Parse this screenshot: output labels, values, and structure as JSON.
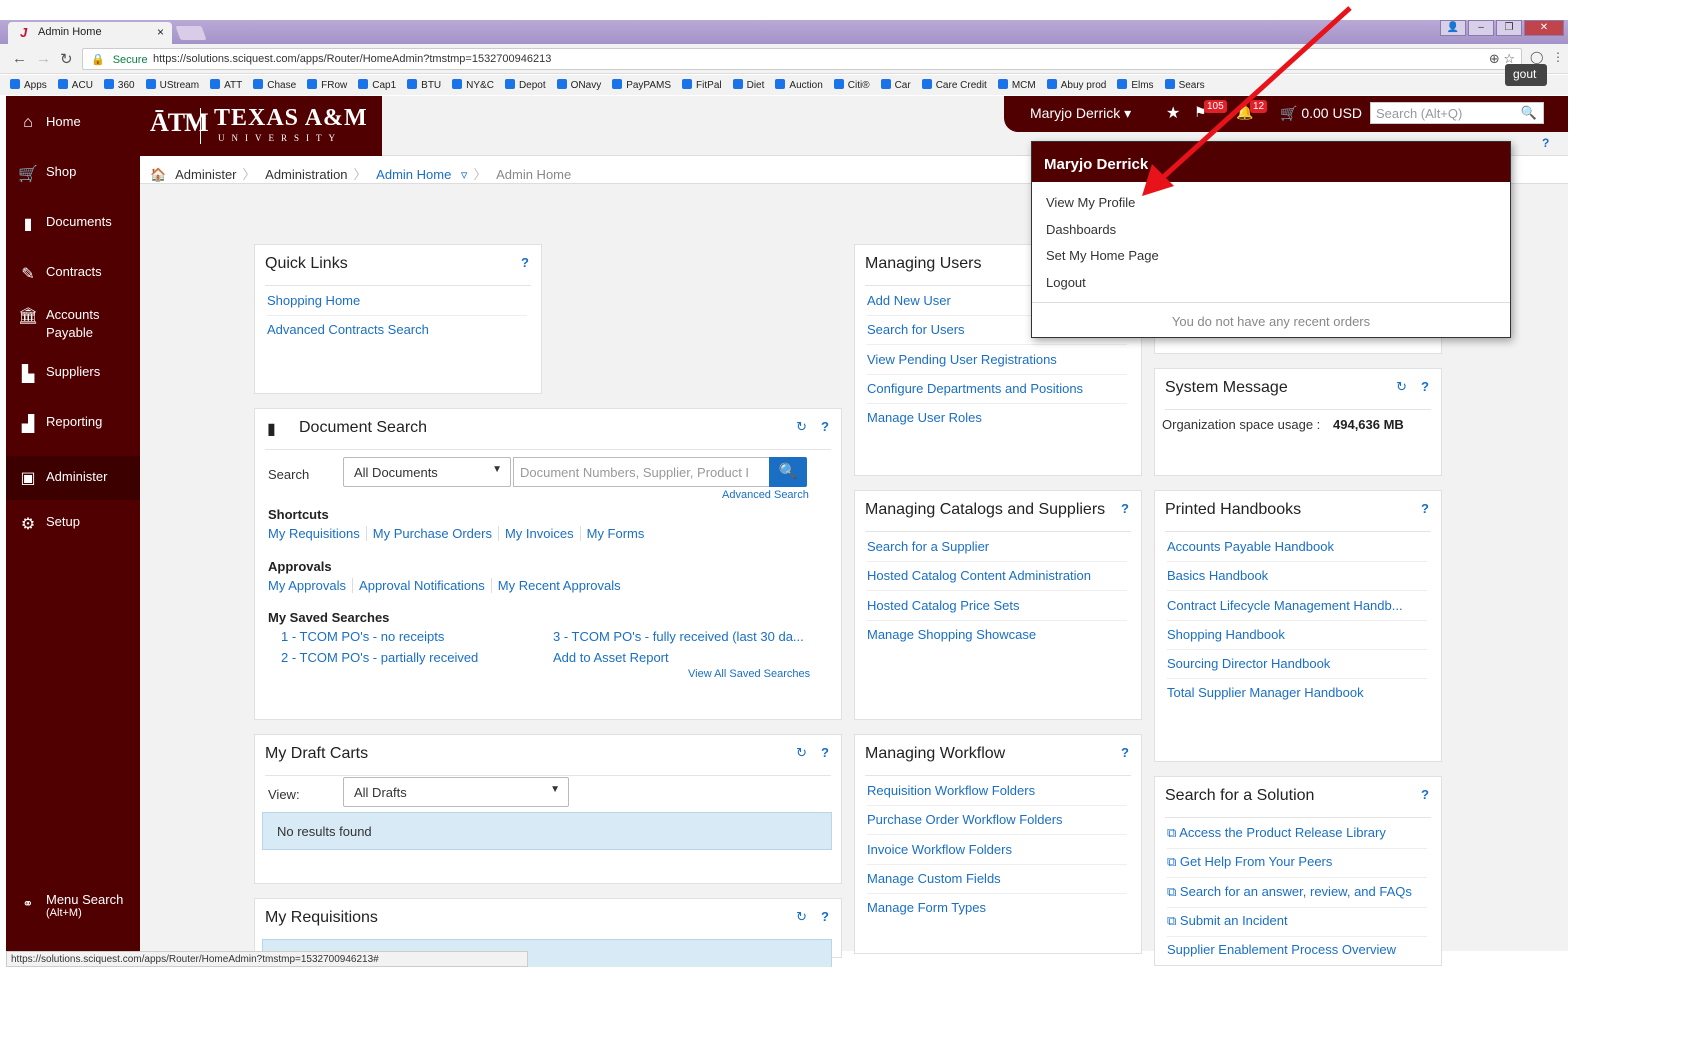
{
  "browser": {
    "tab_title": "Admin Home",
    "secure_label": "Secure",
    "url": "https://solutions.sciquest.com/apps/Router/HomeAdmin?tmstmp=1532700946213",
    "bookmarks": [
      "Apps",
      "ACU",
      "360",
      "UStream",
      "ATT",
      "Chase",
      "FRow",
      "Cap1",
      "BTU",
      "NY&C",
      "Depot",
      "ONavy",
      "PayPAMS",
      "FitPal",
      "Diet",
      "Auction",
      "Citi®",
      "Car",
      "Care Credit",
      "MCM",
      "Abuy prod",
      "Elms",
      "Sears"
    ],
    "status_url": "https://solutions.sciquest.com/apps/Router/HomeAdmin?tmstmp=1532700946213#"
  },
  "logo": {
    "atm": "ĀTM",
    "name": "TEXAS A&M",
    "sub": "UNIVERSITY"
  },
  "sidebar": {
    "items": [
      {
        "label": "Home",
        "icon": "home-icon"
      },
      {
        "label": "Shop",
        "icon": "cart-icon"
      },
      {
        "label": "Documents",
        "icon": "documents-icon"
      },
      {
        "label": "Contracts",
        "icon": "contracts-icon"
      },
      {
        "label": "Accounts Payable",
        "icon": "bank-icon"
      },
      {
        "label": "Suppliers",
        "icon": "suppliers-icon"
      },
      {
        "label": "Reporting",
        "icon": "chart-icon"
      },
      {
        "label": "Administer",
        "icon": "administer-icon"
      },
      {
        "label": "Setup",
        "icon": "gear-icon"
      }
    ],
    "menu_search": "Menu Search",
    "menu_search_shortcut": "(Alt+M)"
  },
  "userbar": {
    "name": "Maryjo Derrick",
    "flag_count": "105",
    "bell_count": "12",
    "cart_total": "0.00 USD",
    "search_placeholder": "Search (Alt+Q)"
  },
  "breadcrumb": {
    "items": [
      "Administer",
      "Administration",
      "Admin Home",
      "Admin Home"
    ],
    "logout_partial": "gout"
  },
  "quick_links": {
    "title": "Quick Links",
    "links": [
      "Shopping Home",
      "Advanced Contracts Search"
    ]
  },
  "document_search": {
    "title": "Document Search",
    "search_label": "Search",
    "select_value": "All Documents",
    "input_placeholder": "Document Numbers, Supplier, Product I",
    "advanced": "Advanced Search",
    "shortcuts_label": "Shortcuts",
    "shortcuts": [
      "My Requisitions",
      "My Purchase Orders",
      "My Invoices",
      "My Forms"
    ],
    "approvals_label": "Approvals",
    "approvals": [
      "My Approvals",
      "Approval Notifications",
      "My Recent Approvals"
    ],
    "saved_label": "My Saved Searches",
    "saved": [
      "1 - TCOM PO's - no receipts",
      "2 - TCOM PO's - partially received",
      "3 - TCOM PO's - fully received (last 30 da...",
      "Add to Asset Report"
    ],
    "view_all": "View All Saved Searches"
  },
  "draft_carts": {
    "title": "My Draft Carts",
    "view_label": "View:",
    "select_value": "All Drafts",
    "empty": "No results found"
  },
  "my_requisitions": {
    "title": "My Requisitions"
  },
  "managing_users": {
    "title": "Managing Users",
    "links": [
      "Add New User",
      "Search for Users",
      "View Pending User Registrations",
      "Configure Departments and Positions",
      "Manage User Roles"
    ]
  },
  "managing_catalogs": {
    "title": "Managing Catalogs and Suppliers",
    "links": [
      "Search for a Supplier",
      "Hosted Catalog Content Administration",
      "Hosted Catalog Price Sets",
      "Manage Shopping Showcase"
    ]
  },
  "managing_workflow": {
    "title": "Managing Workflow",
    "links": [
      "Requisition Workflow Folders",
      "Purchase Order Workflow Folders",
      "Invoice Workflow Folders",
      "Manage Custom Fields",
      "Manage Form Types"
    ]
  },
  "system_message": {
    "title": "System Message",
    "label": "Organization space usage :",
    "value": "494,636 MB"
  },
  "handbooks": {
    "title": "Printed Handbooks",
    "links": [
      "Accounts Payable Handbook",
      "Basics Handbook",
      "Contract Lifecycle Management Handb...",
      "Shopping Handbook",
      "Sourcing Director Handbook",
      "Total Supplier Manager Handbook"
    ]
  },
  "solution": {
    "title": "Search for a Solution",
    "links": [
      "Access the Product Release Library",
      "Get Help From Your Peers",
      "Search for an answer, review, and FAQs",
      "Submit an Incident",
      "Supplier Enablement Process Overview"
    ]
  },
  "user_menu": {
    "title": "Maryjo Derrick",
    "items": [
      "View My Profile",
      "Dashboards",
      "Set My Home Page",
      "Logout"
    ],
    "recent": "You do not have any recent orders"
  },
  "help": "?",
  "colors": {
    "maroon": "#500000",
    "link": "#1a6fc4",
    "arrow": "#e8131a"
  }
}
